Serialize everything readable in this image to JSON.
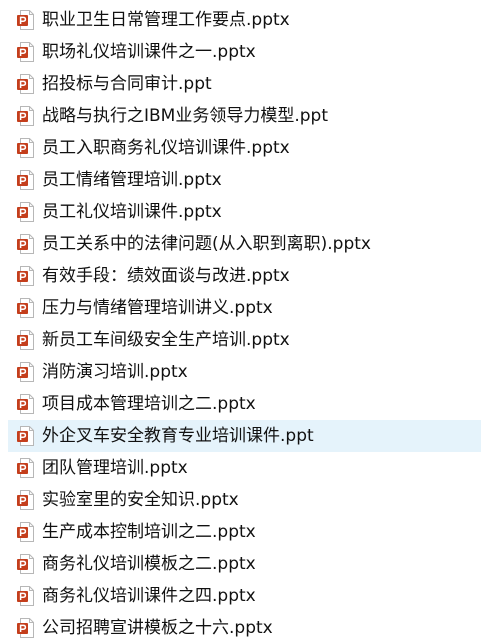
{
  "files": [
    {
      "name": "职业卫生日常管理工作要点.pptx",
      "icon": "powerpoint-file-icon"
    },
    {
      "name": "职场礼仪培训课件之一.pptx",
      "icon": "powerpoint-file-icon"
    },
    {
      "name": "招投标与合同审计.ppt",
      "icon": "powerpoint-file-icon"
    },
    {
      "name": "战略与执行之IBM业务领导力模型.ppt",
      "icon": "powerpoint-file-icon"
    },
    {
      "name": "员工入职商务礼仪培训课件.pptx",
      "icon": "powerpoint-file-icon"
    },
    {
      "name": "员工情绪管理培训.pptx",
      "icon": "powerpoint-file-icon"
    },
    {
      "name": "员工礼仪培训课件.pptx",
      "icon": "powerpoint-file-icon"
    },
    {
      "name": "员工关系中的法律问题(从入职到离职).pptx",
      "icon": "powerpoint-file-icon"
    },
    {
      "name": "有效手段：绩效面谈与改进.pptx",
      "icon": "powerpoint-file-icon"
    },
    {
      "name": "压力与情绪管理培训讲义.pptx",
      "icon": "powerpoint-file-icon"
    },
    {
      "name": "新员工车间级安全生产培训.pptx",
      "icon": "powerpoint-file-icon"
    },
    {
      "name": "消防演习培训.pptx",
      "icon": "powerpoint-file-icon"
    },
    {
      "name": "项目成本管理培训之二.pptx",
      "icon": "powerpoint-file-icon"
    },
    {
      "name": "外企叉车安全教育专业培训课件.ppt",
      "icon": "powerpoint-file-icon"
    },
    {
      "name": "团队管理培训.pptx",
      "icon": "powerpoint-file-icon"
    },
    {
      "name": "实验室里的安全知识.pptx",
      "icon": "powerpoint-file-icon"
    },
    {
      "name": "生产成本控制培训之二.pptx",
      "icon": "powerpoint-file-icon"
    },
    {
      "name": "商务礼仪培训模板之二.pptx",
      "icon": "powerpoint-file-icon"
    },
    {
      "name": "商务礼仪培训课件之四.pptx",
      "icon": "powerpoint-file-icon"
    },
    {
      "name": "公司招聘宣讲模板之十六.pptx",
      "icon": "powerpoint-file-icon"
    }
  ],
  "selected_index": 13,
  "colors": {
    "icon_red": "#c43e1c",
    "icon_page": "#ffffff",
    "icon_border": "#b7b7b7",
    "selection_bg": "#e5f3fb",
    "text": "#111111"
  }
}
